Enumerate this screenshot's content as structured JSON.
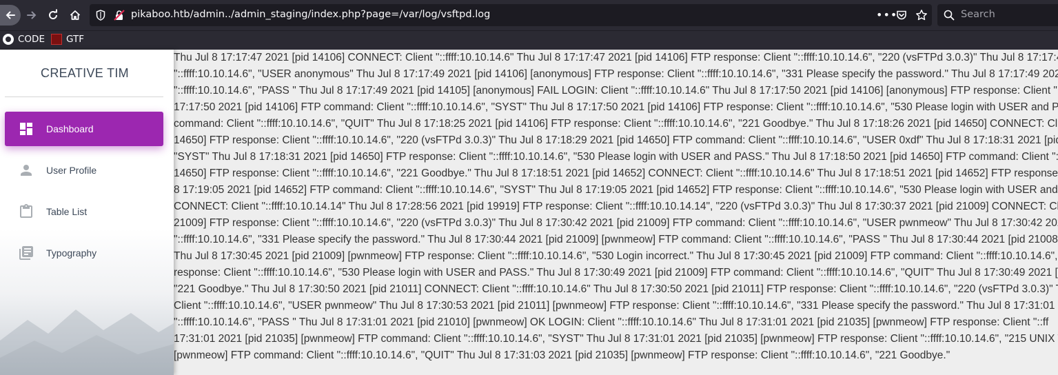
{
  "browser": {
    "url": "pikaboo.htb/admin../admin_staging/index.php?page=/var/log/vsftpd.log",
    "search_placeholder": "Search",
    "more_label": "•••",
    "bookmarks": [
      {
        "label": "CODE",
        "icon": "github-icon"
      },
      {
        "label": "GTF",
        "icon": "gtf-icon"
      }
    ]
  },
  "sidebar": {
    "brand": "CREATIVE TIM",
    "accent_color": "#9c27b0",
    "items": [
      {
        "label": "Dashboard",
        "icon": "dashboard-icon",
        "active": true
      },
      {
        "label": "User Profile",
        "icon": "person-icon",
        "active": false
      },
      {
        "label": "Table List",
        "icon": "clipboard-icon",
        "active": false
      },
      {
        "label": "Typography",
        "icon": "library-books-icon",
        "active": false
      }
    ]
  },
  "log": {
    "lines": [
      "Thu Jul 8 17:17:47 2021 [pid 14106] CONNECT: Client \"::ffff:10.10.14.6\" Thu Jul 8 17:17:47 2021 [pid 14106] FTP response: Client \"::ffff:10.10.14.6\", \"220 (vsFTPd 3.0.3)\" Thu Jul 8 17:17:49",
      "\"::ffff:10.10.14.6\", \"USER anonymous\" Thu Jul 8 17:17:49 2021 [pid 14106] [anonymous] FTP response: Client \"::ffff:10.10.14.6\", \"331 Please specify the password.\" Thu Jul 8 17:17:49 2021",
      "\"::ffff:10.10.14.6\", \"PASS \" Thu Jul 8 17:17:49 2021 [pid 14105] [anonymous] FAIL LOGIN: Client \"::ffff:10.10.14.6\" Thu Jul 8 17:17:50 2021 [pid 14106] [anonymous] FTP response: Client \"::f",
      "17:17:50 2021 [pid 14106] FTP command: Client \"::ffff:10.10.14.6\", \"SYST\" Thu Jul 8 17:17:50 2021 [pid 14106] FTP response: Client \"::ffff:10.10.14.6\", \"530 Please login with USER and PA",
      "command: Client \"::ffff:10.10.14.6\", \"QUIT\" Thu Jul 8 17:18:25 2021 [pid 14106] FTP response: Client \"::ffff:10.10.14.6\", \"221 Goodbye.\" Thu Jul 8 17:18:26 2021 [pid 14650] CONNECT: Client",
      "14650] FTP response: Client \"::ffff:10.10.14.6\", \"220 (vsFTPd 3.0.3)\" Thu Jul 8 17:18:29 2021 [pid 14650] FTP command: Client \"::ffff:10.10.14.6\", \"USER 0xdf\" Thu Jul 8 17:18:31 2021 [pid",
      "\"SYST\" Thu Jul 8 17:18:31 2021 [pid 14650] FTP response: Client \"::ffff:10.10.14.6\", \"530 Please login with USER and PASS.\" Thu Jul 8 17:18:50 2021 [pid 14650] FTP command: Client \"::f",
      "14650] FTP response: Client \"::ffff:10.10.14.6\", \"221 Goodbye.\" Thu Jul 8 17:18:51 2021 [pid 14652] CONNECT: Client \"::ffff:10.10.14.6\" Thu Jul 8 17:18:51 2021 [pid 14652] FTP response: C",
      "8 17:19:05 2021 [pid 14652] FTP command: Client \"::ffff:10.10.14.6\", \"SYST\" Thu Jul 8 17:19:05 2021 [pid 14652] FTP response: Client \"::ffff:10.10.14.6\", \"530 Please login with USER and P",
      "CONNECT: Client \"::ffff:10.10.14.14\" Thu Jul 8 17:28:56 2021 [pid 19919] FTP response: Client \"::ffff:10.10.14.14\", \"220 (vsFTPd 3.0.3)\" Thu Jul 8 17:30:37 2021 [pid 21009] CONNECT: Clie",
      "21009] FTP response: Client \"::ffff:10.10.14.6\", \"220 (vsFTPd 3.0.3)\" Thu Jul 8 17:30:42 2021 [pid 21009] FTP command: Client \"::ffff:10.10.14.6\", \"USER pwnmeow\" Thu Jul 8 17:30:42 2021",
      "\"::ffff:10.10.14.6\", \"331 Please specify the password.\" Thu Jul 8 17:30:44 2021 [pid 21009] [pwnmeow] FTP command: Client \"::ffff:10.10.14.6\", \"PASS \" Thu Jul 8 17:30:44 2021 [pid 21008]",
      "Thu Jul 8 17:30:45 2021 [pid 21009] [pwnmeow] FTP response: Client \"::ffff:10.10.14.6\", \"530 Login incorrect.\" Thu Jul 8 17:30:45 2021 [pid 21009] FTP command: Client \"::ffff:10.10.14.6\",",
      "response: Client \"::ffff:10.10.14.6\", \"530 Please login with USER and PASS.\" Thu Jul 8 17:30:49 2021 [pid 21009] FTP command: Client \"::ffff:10.10.14.6\", \"QUIT\" Thu Jul 8 17:30:49 2021 [pid",
      "\"221 Goodbye.\" Thu Jul 8 17:30:50 2021 [pid 21011] CONNECT: Client \"::ffff:10.10.14.6\" Thu Jul 8 17:30:50 2021 [pid 21011] FTP response: Client \"::ffff:10.10.14.6\", \"220 (vsFTPd 3.0.3)\" Th",
      "Client \"::ffff:10.10.14.6\", \"USER pwnmeow\" Thu Jul 8 17:30:53 2021 [pid 21011] [pwnmeow] FTP response: Client \"::ffff:10.10.14.6\", \"331 Please specify the password.\" Thu Jul 8 17:31:01 2",
      "\"::ffff:10.10.14.6\", \"PASS \" Thu Jul 8 17:31:01 2021 [pid 21010] [pwnmeow] OK LOGIN: Client \"::ffff:10.10.14.6\" Thu Jul 8 17:31:01 2021 [pid 21035] [pwnmeow] FTP response: Client \"::ff",
      "17:31:01 2021 [pid 21035] [pwnmeow] FTP command: Client \"::ffff:10.10.14.6\", \"SYST\" Thu Jul 8 17:31:01 2021 [pid 21035] [pwnmeow] FTP response: Client \"::ffff:10.10.14.6\", \"215 UNIX T",
      "[pwnmeow] FTP command: Client \"::ffff:10.10.14.6\", \"QUIT\" Thu Jul 8 17:31:03 2021 [pid 21035] [pwnmeow] FTP response: Client \"::ffff:10.10.14.6\", \"221 Goodbye.\""
    ]
  }
}
